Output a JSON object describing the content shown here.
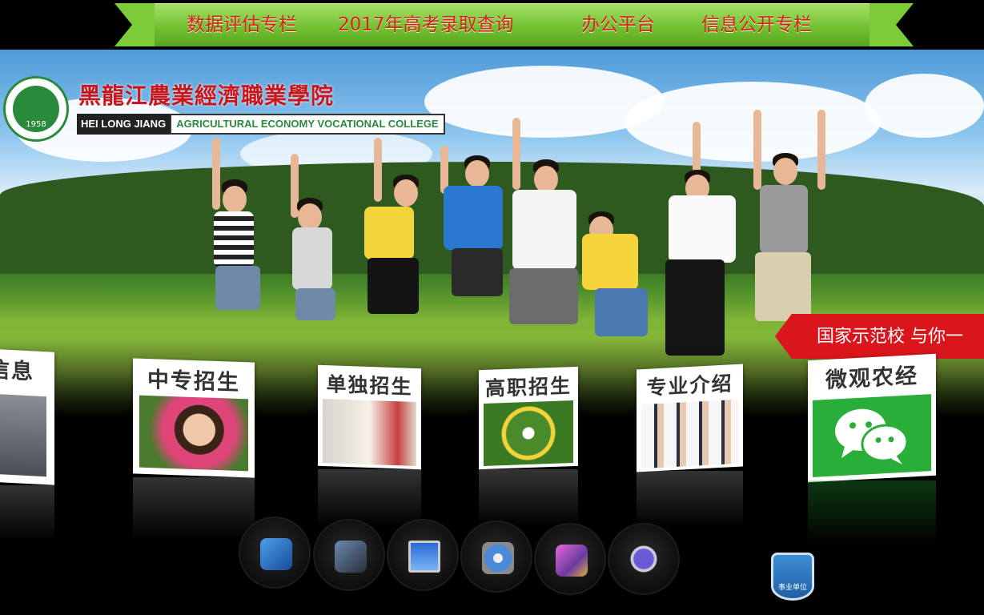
{
  "top_nav": {
    "items": [
      {
        "label": "数据评估专栏"
      },
      {
        "label": "2017年高考录取查询"
      },
      {
        "label": "办公平台"
      },
      {
        "label": "信息公开专栏"
      }
    ]
  },
  "logo": {
    "seal_year": "1958",
    "name_cn": "黑龍江農業經濟職業學院",
    "name_en_a": "HEI LONG JIANG",
    "name_en_b": "AGRICULTURAL ECONOMY VOCATIONAL COLLEGE"
  },
  "slogan": "国家示范校  与你一",
  "cards": [
    {
      "title": "信息"
    },
    {
      "title": "中专招生"
    },
    {
      "title": "单独招生"
    },
    {
      "title": "高职招生"
    },
    {
      "title": "专业介绍"
    },
    {
      "title": "微观农经"
    }
  ],
  "dock": [
    {
      "icon": "photos-icon"
    },
    {
      "icon": "camera-icon"
    },
    {
      "icon": "monitor-icon"
    },
    {
      "icon": "settings-icon"
    },
    {
      "icon": "folder-icon"
    },
    {
      "icon": "search-icon"
    }
  ],
  "badge": "事业单位",
  "colors": {
    "ribbon_green": "#6fbf2e",
    "nav_red": "#d8201c",
    "slogan_red": "#d8161b",
    "wechat_green": "#2aae3a"
  }
}
